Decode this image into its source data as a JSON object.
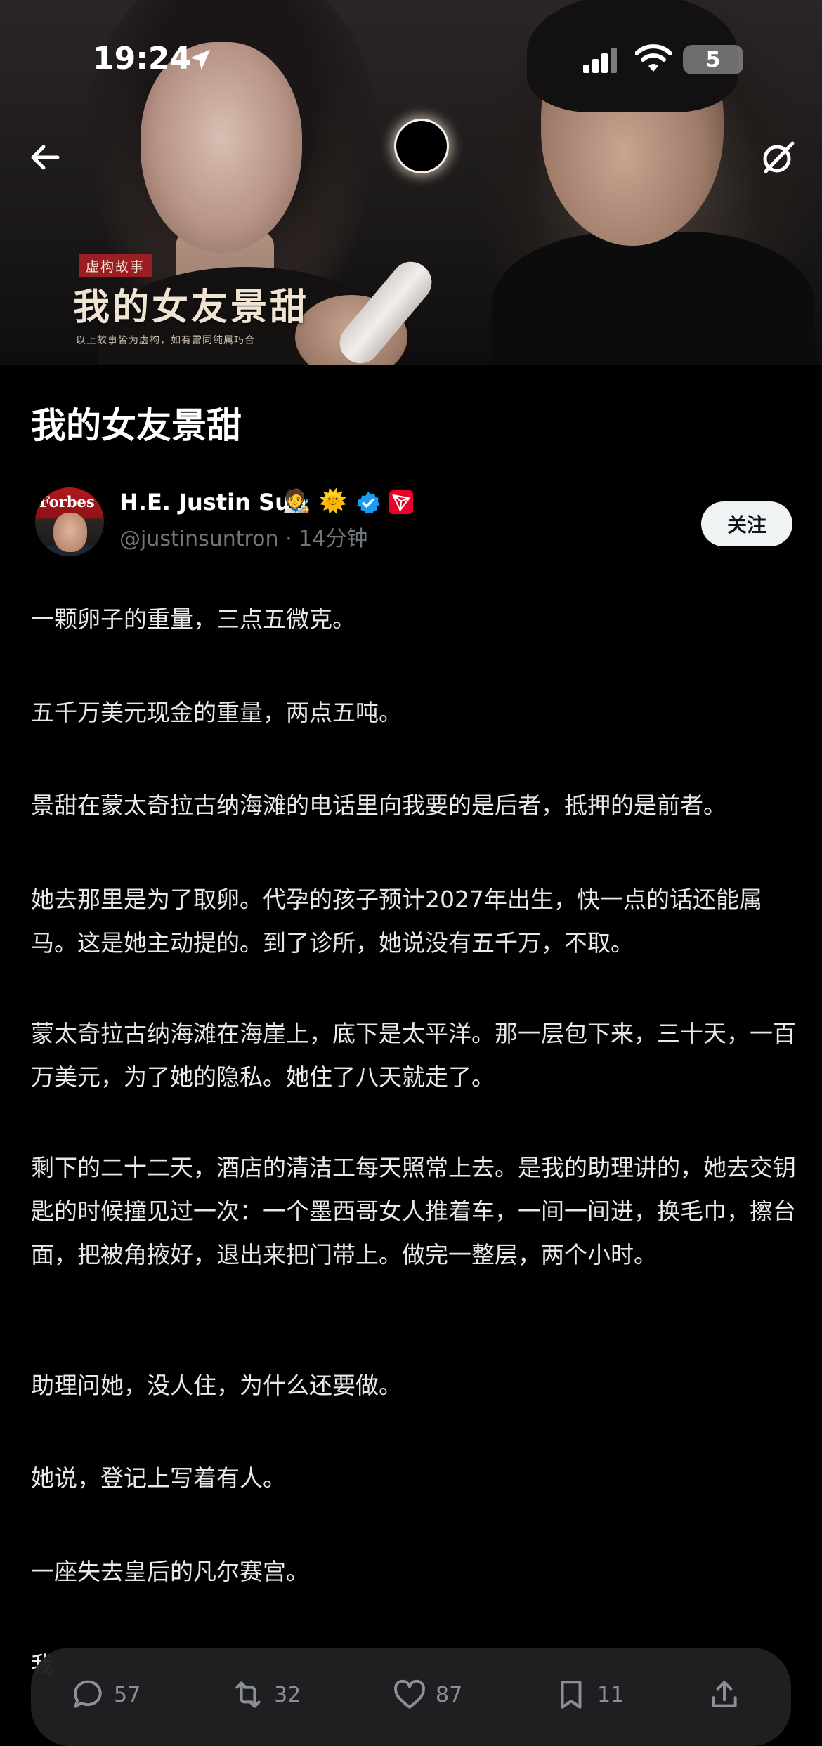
{
  "status_bar": {
    "time": "19:24",
    "battery": "5"
  },
  "hero": {
    "poster_tag": "虚构故事",
    "poster_title": "我的女友景甜",
    "poster_note": "以上故事皆为虚构，如有雷同纯属巧合"
  },
  "article": {
    "title": "我的女友景甜"
  },
  "author": {
    "avatar_text": "Forbes",
    "name": "H.E. Justin Sun",
    "emoji1": "🧑‍🎨",
    "emoji2": "🌞",
    "handle": "@justinsuntron · 14分钟",
    "follow_label": "关注"
  },
  "paragraphs": [
    "一颗卵子的重量，三点五微克。",
    "五千万美元现金的重量，两点五吨。",
    "景甜在蒙太奇拉古纳海滩的电话里向我要的是后者，抵押的是前者。",
    "她去那里是为了取卵。代孕的孩子预计2027年出生，快一点的话还能属马。这是她主动提的。到了诊所，她说没有五千万，不取。",
    "蒙太奇拉古纳海滩在海崖上，底下是太平洋。那一层包下来，三十天，一百万美元，为了她的隐私。她住了八天就走了。",
    "剩下的二十二天，酒店的清洁工每天照常上去。是我的助理讲的，她去交钥匙的时候撞见过一次：一个墨西哥女人推着车，一间一间进，换毛巾，擦台面，把被角掖好，退出来把门带上。做完一整层，两个小时。",
    "助理问她，没人住，为什么还要做。",
    "她说，登记上写着有人。",
    "一座失去皇后的凡尔赛宫。",
    "我"
  ],
  "actions": {
    "replies": "57",
    "reposts": "32",
    "likes": "87",
    "bookmarks": "11"
  },
  "colors": {
    "background": "#000000",
    "text": "#e7e9ea",
    "muted": "#71767b",
    "verified": "#1d9bf0",
    "tron": "#eb0029"
  }
}
